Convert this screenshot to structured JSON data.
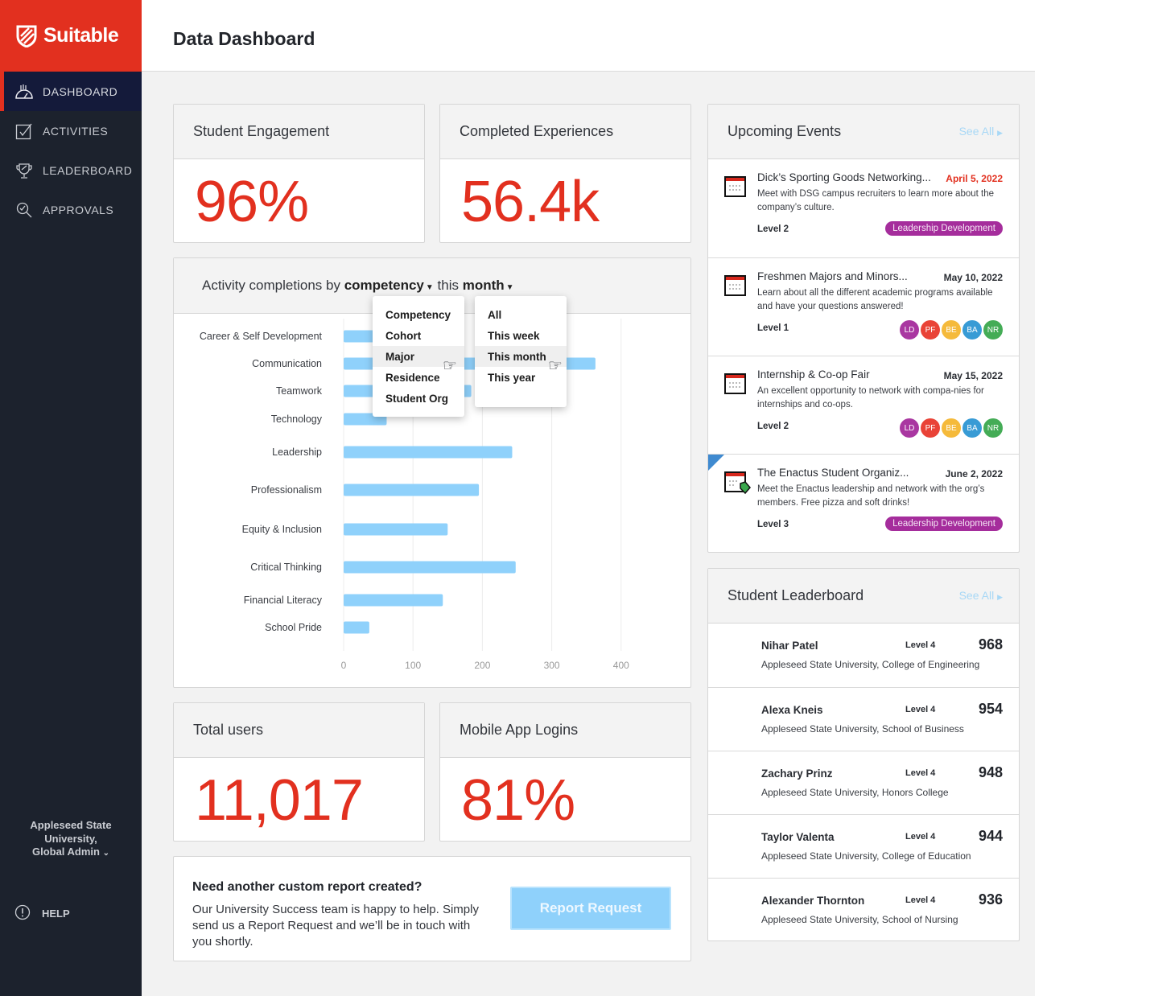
{
  "brand": {
    "name": "Suitable",
    "color": "#e2301f"
  },
  "sidebar": {
    "items": [
      {
        "label": "DASHBOARD",
        "icon": "dashboard-gauge-icon",
        "active": true
      },
      {
        "label": "ACTIVITIES",
        "icon": "checkbox-icon",
        "active": false
      },
      {
        "label": "LEADERBOARD",
        "icon": "trophy-icon",
        "active": false
      },
      {
        "label": "APPROVALS",
        "icon": "approval-search-icon",
        "active": false
      }
    ],
    "org_line1": "Appleseed State",
    "org_line2": "University,",
    "org_line3": "Global Admin",
    "help_label": "HELP"
  },
  "header": {
    "title": "Data Dashboard"
  },
  "stats": {
    "engagement": {
      "label": "Student Engagement",
      "value": "96%"
    },
    "experiences": {
      "label": "Completed Experiences",
      "value": "56.4k"
    },
    "users": {
      "label": "Total users",
      "value": "11,017"
    },
    "logins": {
      "label": "Mobile App Logins",
      "value": "81%"
    }
  },
  "chart_panel": {
    "prefix": "Activity completions by",
    "group_by": "competency",
    "middle": "this",
    "period": "month",
    "group_menu": [
      "Competency",
      "Cohort",
      "Major",
      "Residence",
      "Student Org"
    ],
    "group_hover": "Major",
    "period_menu": [
      "All",
      "This week",
      "This month",
      "This year"
    ],
    "period_hover": "This month"
  },
  "chart_data": {
    "type": "bar",
    "orientation": "horizontal",
    "title": "Activity completions by competency this month",
    "xlabel": "",
    "ylabel": "",
    "categories": [
      "Career & Self Development",
      "Communication",
      "Teamwork",
      "Technology",
      "Leadership",
      "Professionalism",
      "Equity & Inclusion",
      "Critical Thinking",
      "Financial Literacy",
      "School Pride"
    ],
    "values": [
      120,
      363,
      184,
      62,
      243,
      195,
      150,
      248,
      143,
      37
    ],
    "xlim": [
      0,
      450
    ],
    "xticks": [
      0,
      100,
      200,
      300,
      400
    ],
    "grid": true,
    "bar_color": "#8fd1fb"
  },
  "events": {
    "title": "Upcoming Events",
    "see_all": "See All",
    "items": [
      {
        "title": "Dick’s Sporting Goods Networking...",
        "date": "April 5, 2022",
        "date_highlight": true,
        "desc": "Meet with DSG campus recruiters to learn more about the company’s culture.",
        "level": "Level 2",
        "tag": "Leadership Development",
        "badges": []
      },
      {
        "title": "Freshmen Majors and Minors...",
        "date": "May 10, 2022",
        "date_highlight": false,
        "desc": "Learn about all the different academic programs available and have your questions answered!",
        "level": "Level 1",
        "tag": "",
        "badges": [
          {
            "label": "LD",
            "color": "#a52d9c"
          },
          {
            "label": "PF",
            "color": "#e8392d"
          },
          {
            "label": "BE",
            "color": "#f5b731"
          },
          {
            "label": "BA",
            "color": "#2e96d3"
          },
          {
            "label": "NR",
            "color": "#3aa84d"
          }
        ]
      },
      {
        "title": "Internship & Co-op Fair",
        "date": "May 15, 2022",
        "date_highlight": false,
        "desc": "An excellent opportunity to network with compa-nies for internships and co-ops.",
        "level": "Level 2",
        "tag": "",
        "badges": [
          {
            "label": "LD",
            "color": "#a52d9c"
          },
          {
            "label": "PF",
            "color": "#e8392d"
          },
          {
            "label": "BE",
            "color": "#f5b731"
          },
          {
            "label": "BA",
            "color": "#2e96d3"
          },
          {
            "label": "NR",
            "color": "#3aa84d"
          }
        ]
      },
      {
        "title": "The Enactus Student Organiz...",
        "date": "June 2, 2022",
        "date_highlight": false,
        "desc": "Meet the Enactus leadership and network with the org’s members. Free pizza and soft drinks!",
        "level": "Level 3",
        "tag": "Leadership Development",
        "badges": [],
        "flagged": true
      }
    ]
  },
  "leaderboard": {
    "title": "Student Leaderboard",
    "see_all": "See All",
    "items": [
      {
        "name": "Nihar Patel",
        "level": "Level 4",
        "points": "968",
        "school": "Appleseed State University, College of Engineering"
      },
      {
        "name": "Alexa Kneis",
        "level": "Level 4",
        "points": "954",
        "school": "Appleseed State University, School of Business"
      },
      {
        "name": "Zachary Prinz",
        "level": "Level 4",
        "points": "948",
        "school": "Appleseed State University, Honors College"
      },
      {
        "name": "Taylor Valenta",
        "level": "Level 4",
        "points": "944",
        "school": "Appleseed State University, College of Education"
      },
      {
        "name": "Alexander Thornton",
        "level": "Level 4",
        "points": "936",
        "school": "Appleseed State University, School of Nursing"
      }
    ]
  },
  "report": {
    "title": "Need another custom report created?",
    "text": "Our University Success team is happy to help. Simply send us a Report Request and we’ll be in touch with you shortly.",
    "button": "Report Request"
  }
}
